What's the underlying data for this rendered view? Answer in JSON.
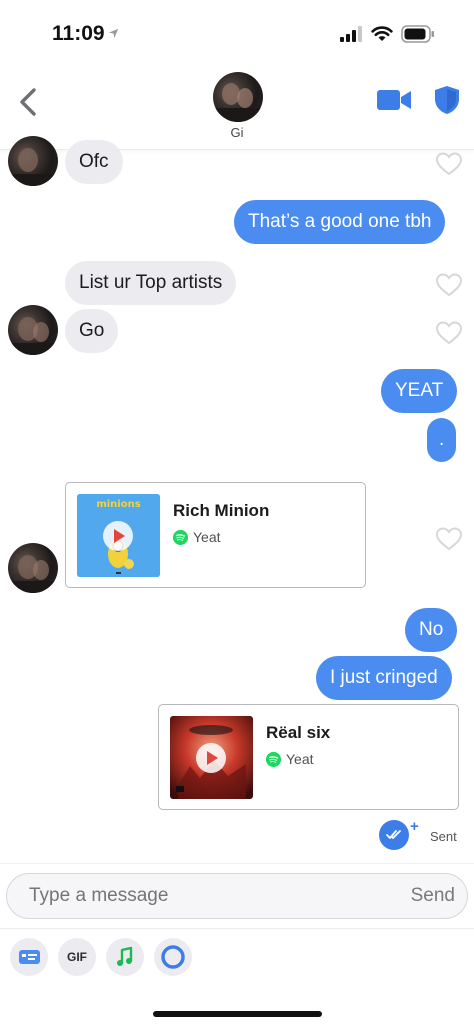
{
  "status_bar": {
    "time": "11:09"
  },
  "header": {
    "contact_name": "Gi"
  },
  "messages": [
    {
      "direction": "in",
      "text": "Ofc"
    },
    {
      "direction": "out",
      "text": "That’s a good one tbh"
    },
    {
      "direction": "in",
      "text": "List ur Top artists"
    },
    {
      "direction": "in",
      "text": "Go"
    },
    {
      "direction": "out",
      "text": "YEAT"
    },
    {
      "direction": "out",
      "text": "."
    },
    {
      "direction": "in",
      "type": "track",
      "title": "Rich Minion",
      "artist": "Yeat",
      "cover_text": "minions"
    },
    {
      "direction": "out",
      "text": "No"
    },
    {
      "direction": "out",
      "text": "I just cringed"
    },
    {
      "direction": "out",
      "type": "track",
      "title": "Rëal six",
      "artist": "Yeat"
    }
  ],
  "receipt": {
    "label": "Sent"
  },
  "composer": {
    "placeholder": "Type a message",
    "send_label": "Send"
  },
  "toolbar": {
    "gif_label": "GIF"
  },
  "colors": {
    "outgoing_bubble": "#4a8cf0",
    "incoming_bubble": "#ececf0",
    "accent": "#3d7de8",
    "spotify": "#1ed760"
  }
}
